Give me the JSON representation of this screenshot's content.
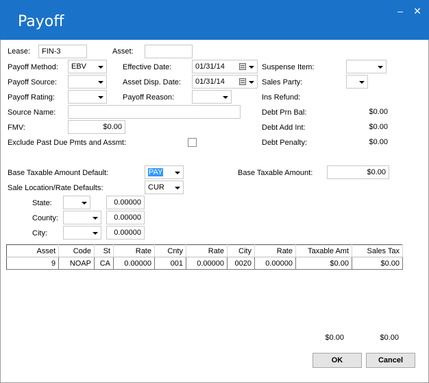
{
  "window": {
    "title": "Payoff",
    "minimize_icon": "minimize-icon",
    "close_icon": "close-icon"
  },
  "lease": {
    "label": "Lease:",
    "value": "FIN-3"
  },
  "asset": {
    "label": "Asset:",
    "value": ""
  },
  "payoff_method": {
    "label": "Payoff Method:",
    "value": "EBV"
  },
  "effective_date": {
    "label": "Effective Date:",
    "value": "01/31/14"
  },
  "suspense_item": {
    "label": "Suspense Item:",
    "value": ""
  },
  "payoff_source": {
    "label": "Payoff Source:",
    "value": ""
  },
  "asset_disp_date": {
    "label": "Asset Disp. Date:",
    "value": "01/31/14"
  },
  "sales_party": {
    "label": "Sales Party:",
    "value": ""
  },
  "payoff_rating": {
    "label": "Payoff Rating:",
    "value": ""
  },
  "payoff_reason": {
    "label": "Payoff Reason:",
    "value": ""
  },
  "ins_refund": {
    "label": "Ins Refund:"
  },
  "source_name": {
    "label": "Source Name:",
    "value": ""
  },
  "debt_prn_bal": {
    "label": "Debt Prn Bal:",
    "value": "$0.00"
  },
  "fmv": {
    "label": "FMV:",
    "value": "$0.00"
  },
  "debt_add_int": {
    "label": "Debt Add Int:",
    "value": "$0.00"
  },
  "exclude_past_due": {
    "label": "Exclude Past Due Pmts and Assmt:",
    "checked": false
  },
  "debt_penalty": {
    "label": "Debt Penalty:",
    "value": "$0.00"
  },
  "base_taxable_default": {
    "label": "Base Taxable Amount Default:",
    "value": "PAY"
  },
  "base_taxable_amount": {
    "label": "Base Taxable Amount:",
    "value": "$0.00"
  },
  "sale_location": {
    "label": "Sale Location/Rate Defaults:",
    "value": "CUR"
  },
  "state": {
    "label": "State:",
    "value": "",
    "rate": "0.00000"
  },
  "county": {
    "label": "County:",
    "value": "",
    "rate": "0.00000"
  },
  "city": {
    "label": "City:",
    "value": "",
    "rate": "0.00000"
  },
  "grid": {
    "columns": [
      "Asset",
      "Code",
      "St",
      "Rate",
      "Cnty",
      "Rate",
      "City",
      "Rate",
      "Taxable Amt",
      "Sales Tax"
    ],
    "rows": [
      [
        "9",
        "NOAP",
        "CA",
        "0.00000",
        "001",
        "0.00000",
        "0020",
        "0.00000",
        "$0.00",
        "$0.00"
      ]
    ]
  },
  "totals": {
    "taxable_amt": "$0.00",
    "sales_tax": "$0.00"
  },
  "buttons": {
    "ok": "OK",
    "cancel": "Cancel"
  }
}
